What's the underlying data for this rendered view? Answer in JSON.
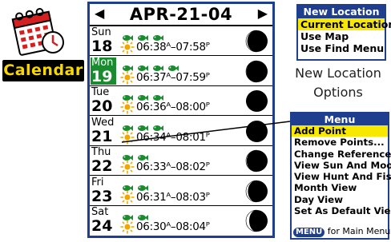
{
  "app": {
    "label": "Calendar"
  },
  "calendar": {
    "title": "APR-21-04",
    "prev_arrow": "◀",
    "next_arrow": "▶",
    "rows": [
      {
        "day": "Sun",
        "date": "18",
        "times": "06:38ᴬ–07:58ᴾ",
        "fish": 3,
        "selected": false
      },
      {
        "day": "Mon",
        "date": "19",
        "times": "06:37ᴬ–07:59ᴾ",
        "fish": 4,
        "selected": true
      },
      {
        "day": "Tue",
        "date": "20",
        "times": "06:36ᴬ–08:00ᴾ",
        "fish": 3,
        "selected": false
      },
      {
        "day": "Wed",
        "date": "21",
        "times": "06:34ᴬ–08:01ᴾ",
        "fish": 3,
        "selected": false
      },
      {
        "day": "Thu",
        "date": "22",
        "times": "06:33ᴬ–08:02ᴾ",
        "fish": 2,
        "selected": false
      },
      {
        "day": "Fri",
        "date": "23",
        "times": "06:31ᴬ–08:03ᴾ",
        "fish": 2,
        "selected": false
      },
      {
        "day": "Sat",
        "date": "24",
        "times": "06:30ᴬ–08:04ᴾ",
        "fish": 2,
        "selected": false
      }
    ]
  },
  "new_location": {
    "header": "New Location",
    "items": [
      "Current Location",
      "Use Map",
      "Use Find Menu"
    ],
    "highlighted_index": 0
  },
  "caption": {
    "line1": "New Location",
    "line2": "Options"
  },
  "menu": {
    "header": "Menu",
    "items": [
      "Add Point",
      "Remove Points...",
      "Change Reference",
      "View Sun And Moon",
      "View Hunt And Fish",
      "Month View",
      "Day View",
      "Set As Default View"
    ],
    "highlighted_index": 0,
    "footer_button": "MENU",
    "footer_text": " for Main Menu"
  },
  "colors": {
    "frame": "#1f3f8e",
    "highlight": "#f8e800",
    "selected_day": "#1a8c2f",
    "fish": "#1a8c2f",
    "sun": "#f0a800"
  }
}
